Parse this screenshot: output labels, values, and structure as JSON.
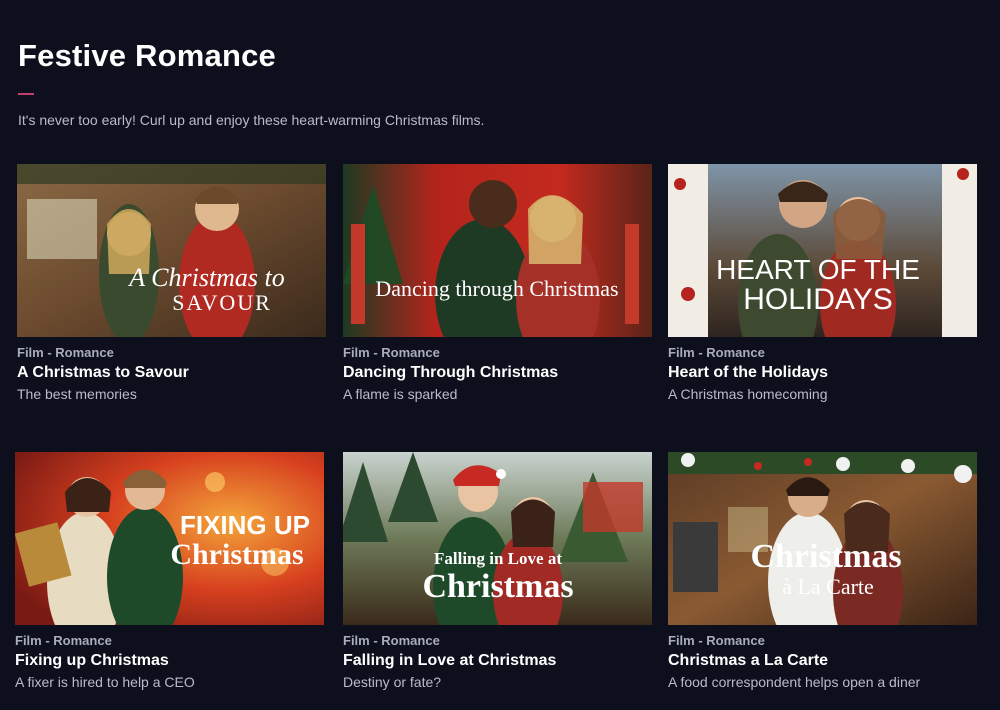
{
  "section": {
    "title": "Festive Romance",
    "description": "It's never too early! Curl up and enjoy these heart-warming Christmas films."
  },
  "films": [
    {
      "category": "Film - Romance",
      "title": "A Christmas to Savour",
      "subtitle": "The best memories",
      "poster": {
        "line1": "A Christmas to",
        "line2": "SAVOUR"
      }
    },
    {
      "category": "Film - Romance",
      "title": "Dancing Through Christmas",
      "subtitle": "A flame is sparked",
      "poster": {
        "line1": "Dancing through Christmas",
        "line2": ""
      }
    },
    {
      "category": "Film - Romance",
      "title": "Heart of the Holidays",
      "subtitle": "A Christmas homecoming",
      "poster": {
        "line1": "HEART OF THE",
        "line2": "HOLIDAYS"
      }
    },
    {
      "category": "Film - Romance",
      "title": "Fixing up Christmas",
      "subtitle": "A fixer is hired to help a CEO",
      "poster": {
        "line1": "FIXING UP",
        "line2": "Christmas"
      }
    },
    {
      "category": "Film - Romance",
      "title": "Falling in Love at Christmas",
      "subtitle": "Destiny or fate?",
      "poster": {
        "line1": "Falling in Love at",
        "line2": "Christmas"
      }
    },
    {
      "category": "Film - Romance",
      "title": "Christmas a La Carte",
      "subtitle": "A food correspondent helps open a diner",
      "poster": {
        "line1": "Christmas",
        "line2": "à La Carte"
      }
    }
  ],
  "colors": {
    "background": "#0d0f1c",
    "accent": "#c2416a"
  }
}
